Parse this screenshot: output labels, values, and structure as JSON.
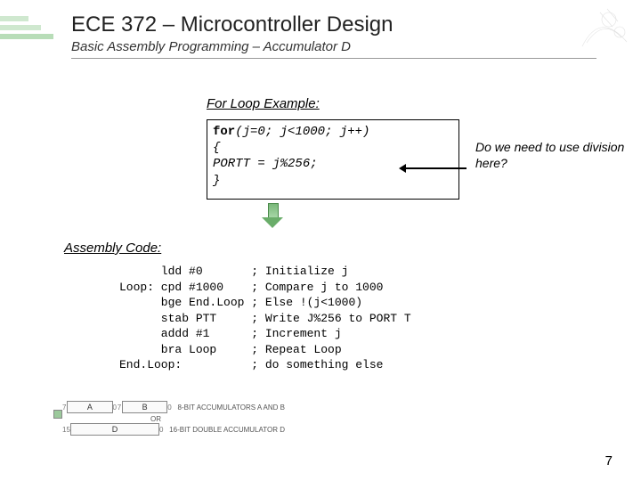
{
  "header": {
    "title": "ECE 372 – Microcontroller Design",
    "subtitle": "Basic Assembly Programming – Accumulator D"
  },
  "example": {
    "heading": "For Loop Example:",
    "code": {
      "l1a": "for",
      "l1b": "(j=0; j<1000; j++)",
      "l2": "{",
      "l3": "   PORTT = j%256;",
      "l4": "}"
    },
    "note": "Do we need to use division here?"
  },
  "asm": {
    "heading": "Assembly Code:",
    "lines": [
      "      ldd #0       ; Initialize j",
      "Loop: cpd #1000    ; Compare j to 1000",
      "      bge End.Loop ; Else !(j<1000)",
      "      stab PTT     ; Write J%256 to PORT T",
      "      addd #1      ; Increment j",
      "      bra Loop     ; Repeat Loop",
      "End.Loop:          ; do something else"
    ]
  },
  "diagram": {
    "bit7a": "7",
    "labelA": "A",
    "bit0a": "0",
    "bit7b": "7",
    "labelB": "B",
    "bit0b": "0",
    "sideAB": "8-BIT ACCUMULATORS A AND B",
    "or": "OR",
    "bit15": "15",
    "labelD": "D",
    "bit0d": "0",
    "sideD": "16-BIT DOUBLE ACCUMULATOR D"
  },
  "page": "7"
}
